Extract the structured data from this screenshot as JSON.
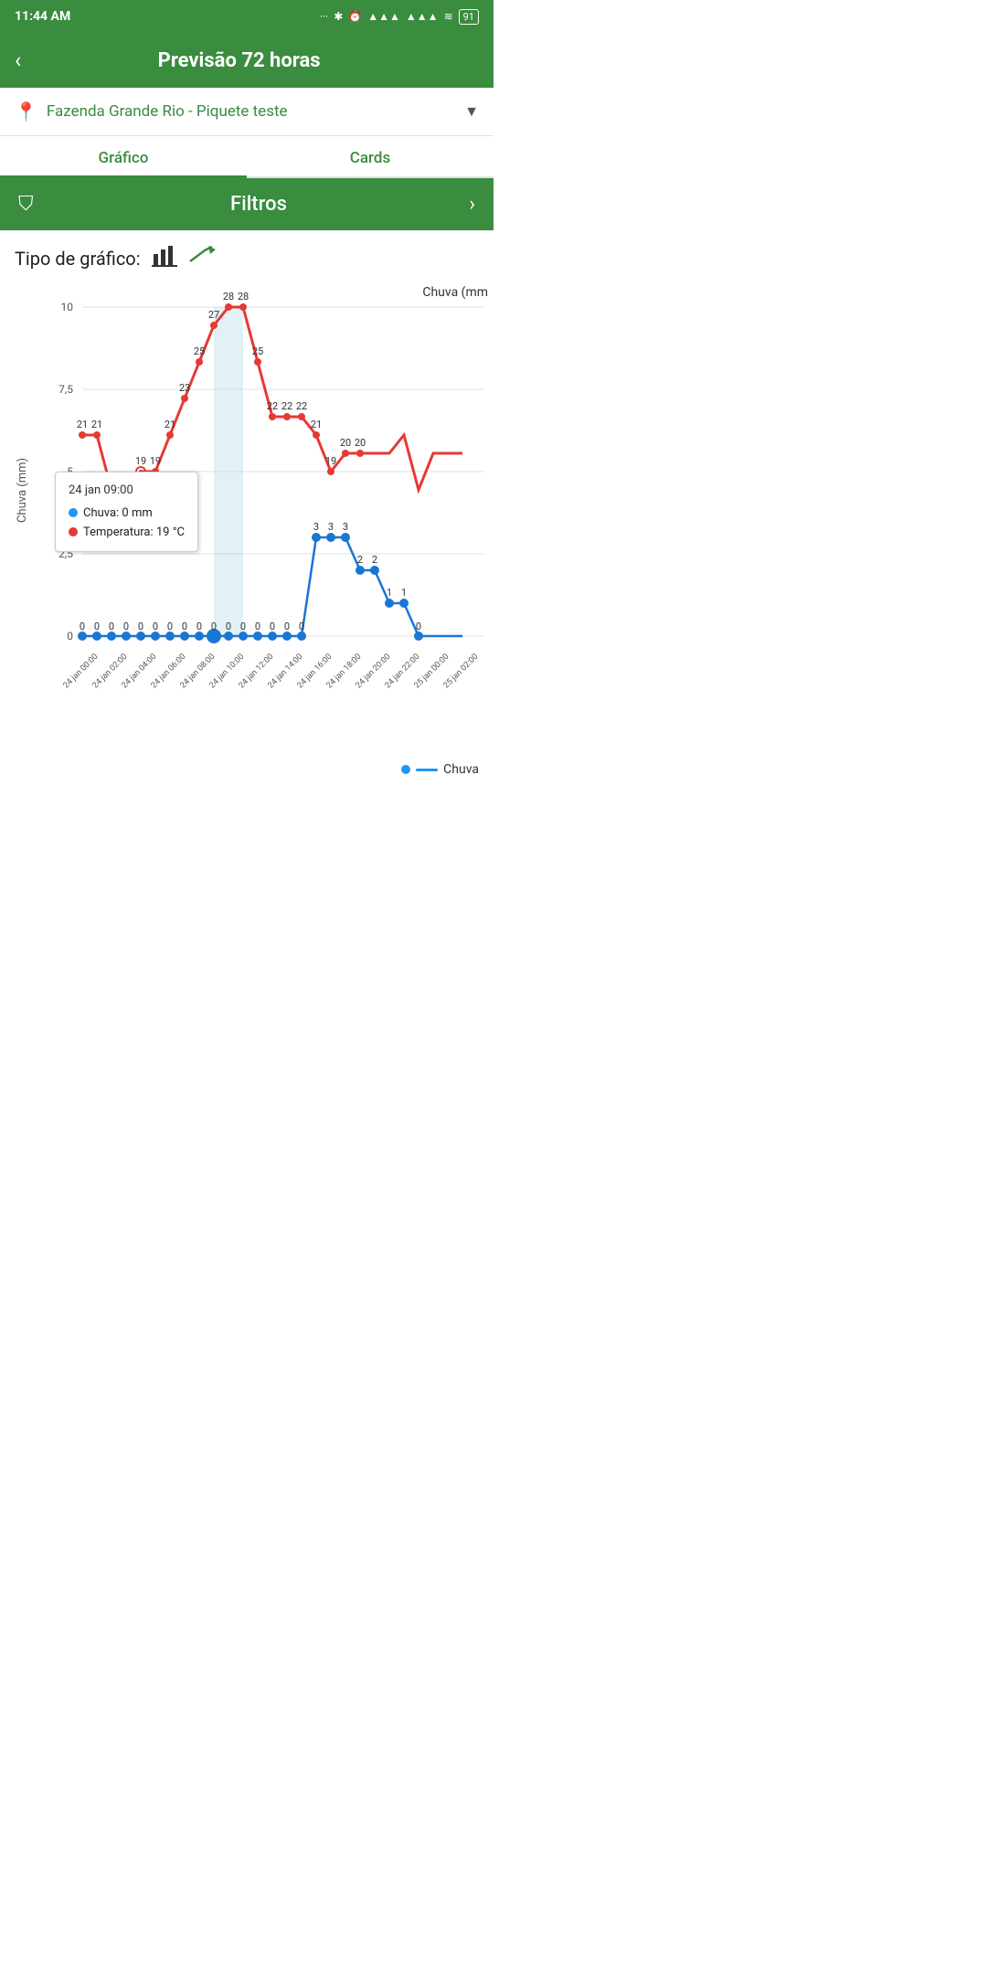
{
  "statusBar": {
    "time": "11:44 AM",
    "batteryLevel": "91"
  },
  "header": {
    "backLabel": "‹",
    "title": "Previsão 72 horas"
  },
  "location": {
    "icon": "📍",
    "text": "Fazenda Grande Rio - Piquete teste",
    "dropdownIcon": "▼"
  },
  "tabs": [
    {
      "label": "Gráfico",
      "active": true
    },
    {
      "label": "Cards",
      "active": false
    }
  ],
  "filtros": {
    "icon": "⛃",
    "label": "Filtros",
    "arrow": "›"
  },
  "chartType": {
    "label": "Tipo de gráfico:",
    "barIcon": "📊",
    "lineIcon": "📈"
  },
  "chart": {
    "yAxisLabel": "Chuva (mm)",
    "rightLabel": "Chuva (mm",
    "yAxisValues": [
      "10",
      "7,5",
      "5",
      "2,5",
      "0"
    ],
    "tooltip": {
      "title": "24 jan 09:00",
      "chuva": "Chuva: 0 mm",
      "temperatura": "Temperatura: 19 °C"
    }
  },
  "legend": {
    "chuvaLabel": "Chuva"
  }
}
